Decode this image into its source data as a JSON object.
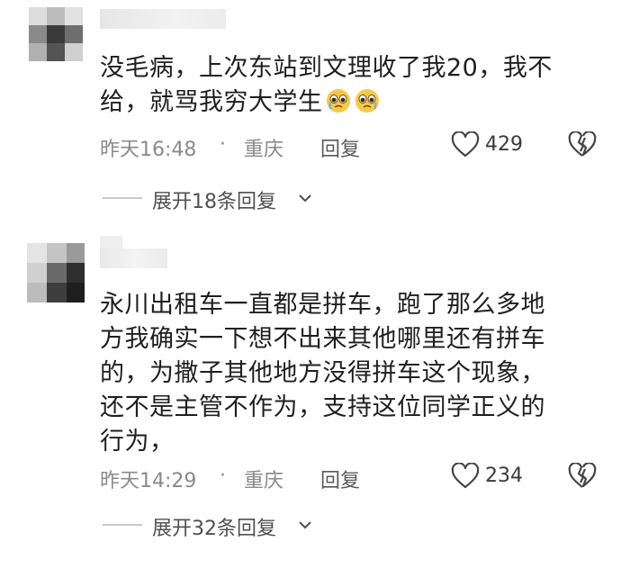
{
  "comments": [
    {
      "text_line1": "没毛病，上次东站到文理收了我20，我不",
      "text_line2": "给，就骂我穷大学生",
      "emoji": "pleading-face-icon",
      "time": "昨天16:48",
      "separator": "·",
      "location": "重庆",
      "reply_label": "回复",
      "likes": "429",
      "expand_label": "展开18条回复"
    },
    {
      "text_lines": [
        "永川出租车一直都是拼车，跑了那么多地",
        "方我确实一下想不出来其他哪里还有拼车",
        "的，为撒子其他地方没得拼车这个现象，",
        "还不是主管不作为，支持这位同学正义的",
        "行为，"
      ],
      "time": "昨天14:29",
      "separator": "·",
      "location": "重庆",
      "reply_label": "回复",
      "likes": "234",
      "expand_label": "展开32条回复"
    }
  ],
  "colors": {
    "meta_text": "#8a8a8a",
    "body_text": "#1f1f1f",
    "divider": "#c8c8c8"
  }
}
